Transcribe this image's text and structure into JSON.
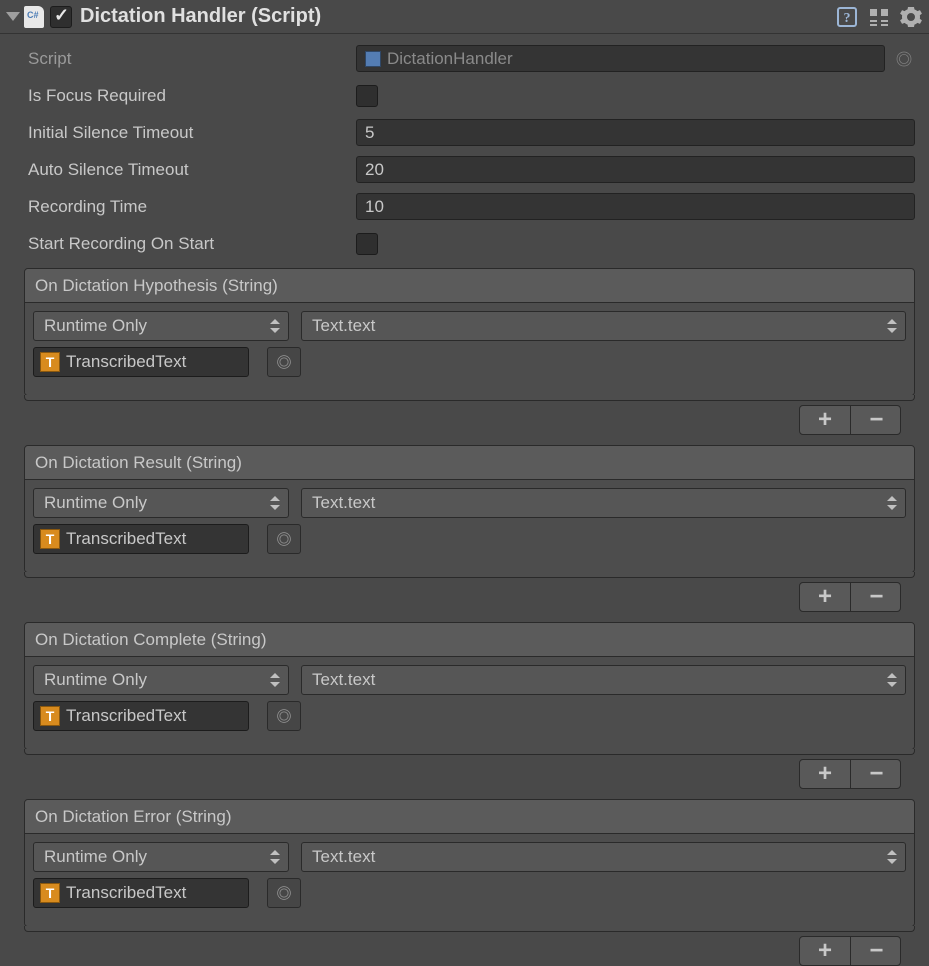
{
  "component": {
    "enabled": true,
    "title": "Dictation Handler (Script)"
  },
  "props": {
    "script_label": "Script",
    "script_value": "DictationHandler",
    "is_focus_label": "Is Focus Required",
    "is_focus_value": false,
    "init_silence_label": "Initial Silence Timeout",
    "init_silence_value": "5",
    "auto_silence_label": "Auto Silence Timeout",
    "auto_silence_value": "20",
    "rec_time_label": "Recording Time",
    "rec_time_value": "10",
    "start_on_start_label": "Start Recording On Start",
    "start_on_start_value": false
  },
  "events": [
    {
      "title": "On Dictation Hypothesis (String)",
      "mode": "Runtime Only",
      "func": "Text.text",
      "target": "TranscribedText"
    },
    {
      "title": "On Dictation Result (String)",
      "mode": "Runtime Only",
      "func": "Text.text",
      "target": "TranscribedText"
    },
    {
      "title": "On Dictation Complete (String)",
      "mode": "Runtime Only",
      "func": "Text.text",
      "target": "TranscribedText"
    },
    {
      "title": "On Dictation Error (String)",
      "mode": "Runtime Only",
      "func": "Text.text",
      "target": "TranscribedText"
    }
  ],
  "icons": {
    "t": "T",
    "plus": "+",
    "minus": "−"
  }
}
